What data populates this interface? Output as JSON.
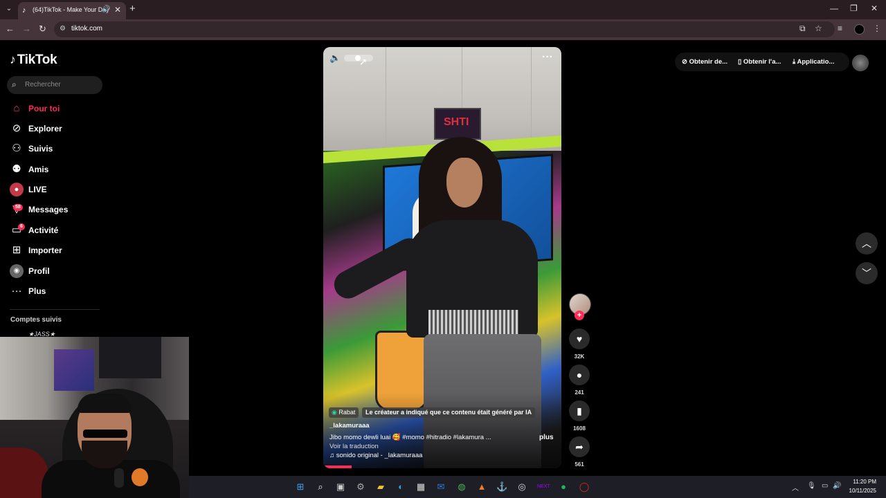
{
  "browser": {
    "tab_title": "(64)TikTok - Make Your Day",
    "url": "tiktok.com",
    "new_tab": "+",
    "icons": [
      "tab-list-icon",
      "speaker-icon",
      "close-icon",
      "back-icon",
      "forward-icon",
      "reload-icon",
      "site-info-icon",
      "install-icon",
      "bookmark-star-icon",
      "media-controls-icon",
      "profile-icon",
      "menu-icon"
    ]
  },
  "tiktok": {
    "logo": "TikTok",
    "search_placeholder": "Rechercher",
    "nav": [
      {
        "label": "Pour toi",
        "icon": "home-icon",
        "active": true
      },
      {
        "label": "Explorer",
        "icon": "compass-icon"
      },
      {
        "label": "Suivis",
        "icon": "following-icon"
      },
      {
        "label": "Amis",
        "icon": "friends-icon"
      },
      {
        "label": "LIVE",
        "icon": "live-icon"
      },
      {
        "label": "Messages",
        "icon": "messages-icon",
        "badge": "58"
      },
      {
        "label": "Activité",
        "icon": "activity-icon",
        "badge": "6"
      },
      {
        "label": "Importer",
        "icon": "upload-icon"
      },
      {
        "label": "Profil",
        "icon": "profile-icon"
      },
      {
        "label": "Plus",
        "icon": "more-icon"
      }
    ],
    "followed_heading": "Comptes suivis",
    "followed_first": "★JASS★",
    "topbar": {
      "chip1": "Obtenir de...",
      "chip2": "Obtenir l'a...",
      "chip3": "Applicatio..."
    }
  },
  "video": {
    "location": "Rabat",
    "ai_label": "Le créateur a indiqué que ce contenu était généré par IA",
    "username": "_lakamuraaa",
    "caption": "Jibo momo dewli luai 🥰 #momo #hitradio #lakamura ...",
    "more": "plus",
    "translate": "Voir la traduction",
    "sound": "sonido original - _lakamuraaa",
    "sign_text": "SHTI",
    "likes": "32K",
    "comments": "241",
    "saves": "1608",
    "shares": "561",
    "progress": 0.12
  },
  "taskbar": {
    "time": "11:20 PM",
    "date": "10/11/2025",
    "apps": [
      "windows-start-icon",
      "search-icon",
      "task-view-icon",
      "settings-icon",
      "file-explorer-icon",
      "edge-icon",
      "store-icon",
      "outlook-icon",
      "chrome-icon",
      "app-icon",
      "steam-icon",
      "obs-icon",
      "kick-icon",
      "spotify-icon",
      "opera-gx-icon"
    ]
  }
}
